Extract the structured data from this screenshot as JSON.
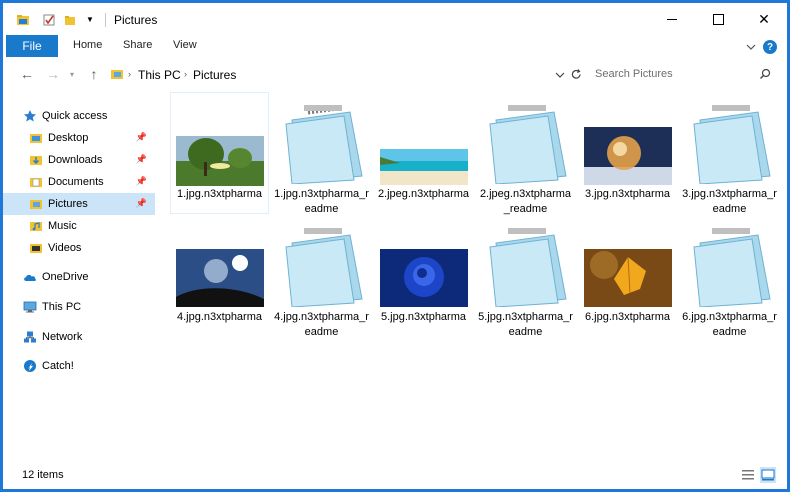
{
  "window": {
    "title": "Pictures"
  },
  "ribbon": {
    "tabs": [
      "File",
      "Home",
      "Share",
      "View"
    ],
    "help": "?"
  },
  "address": {
    "parts": [
      "This PC",
      "Pictures"
    ]
  },
  "search": {
    "placeholder": "Search Pictures"
  },
  "sidebar": {
    "items": [
      {
        "label": "Quick access",
        "icon": "star-icon",
        "pinned": false
      },
      {
        "label": "Desktop",
        "icon": "desktop-folder-icon",
        "pinned": true
      },
      {
        "label": "Downloads",
        "icon": "downloads-folder-icon",
        "pinned": true
      },
      {
        "label": "Documents",
        "icon": "documents-folder-icon",
        "pinned": true
      },
      {
        "label": "Pictures",
        "icon": "pictures-folder-icon",
        "pinned": true,
        "selected": true
      },
      {
        "label": "Music",
        "icon": "music-folder-icon",
        "pinned": false
      },
      {
        "label": "Videos",
        "icon": "videos-folder-icon",
        "pinned": false
      },
      {
        "label": "OneDrive",
        "icon": "cloud-icon",
        "pinned": false
      },
      {
        "label": "This PC",
        "icon": "computer-icon",
        "pinned": false
      },
      {
        "label": "Network",
        "icon": "network-icon",
        "pinned": false
      },
      {
        "label": "Catch!",
        "icon": "catch-icon",
        "pinned": false
      }
    ]
  },
  "files": [
    {
      "name": "1.jpg.n3xtpharma",
      "kind": "image",
      "thumb": "park-trees"
    },
    {
      "name": "1.jpg.n3xtpharma_readme",
      "kind": "notepad"
    },
    {
      "name": "2.jpeg.n3xtpharma",
      "kind": "image",
      "thumb": "beach"
    },
    {
      "name": "2.jpeg.n3xtpharma_readme",
      "kind": "notepad"
    },
    {
      "name": "3.jpg.n3xtpharma",
      "kind": "image",
      "thumb": "bubble-snow"
    },
    {
      "name": "3.jpg.n3xtpharma_readme",
      "kind": "notepad"
    },
    {
      "name": "4.jpg.n3xtpharma",
      "kind": "image",
      "thumb": "moon-globe"
    },
    {
      "name": "4.jpg.n3xtpharma_readme",
      "kind": "notepad"
    },
    {
      "name": "5.jpg.n3xtpharma",
      "kind": "image",
      "thumb": "blue-rose"
    },
    {
      "name": "5.jpg.n3xtpharma_readme",
      "kind": "notepad"
    },
    {
      "name": "6.jpg.n3xtpharma",
      "kind": "image",
      "thumb": "autumn-leaves"
    },
    {
      "name": "6.jpg.n3xtpharma_readme",
      "kind": "notepad"
    }
  ],
  "status": {
    "item_count": "12 items"
  },
  "colors": {
    "accent": "#1979ca",
    "border": "#1e78d7",
    "selected": "#cce4f7"
  }
}
